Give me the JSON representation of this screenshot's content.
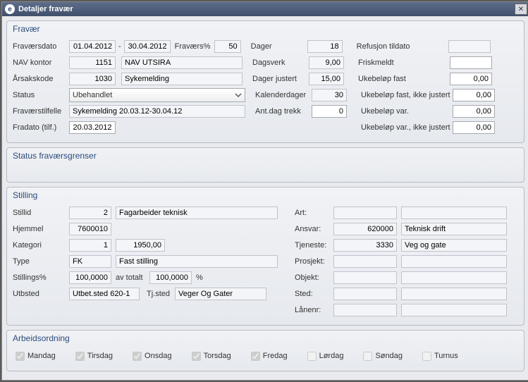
{
  "window": {
    "title": "Detaljer fravær"
  },
  "fravaer": {
    "legend": "Fravær",
    "fravaersdato_label": "Fraværsdato",
    "dato_fra": "01.04.2012",
    "dato_til": "30.04.2012",
    "fravaerspct_label": "Fraværs%",
    "fravaerspct": "50",
    "dager_label": "Dager",
    "dager": "18",
    "refusjon_label": "Refusjon tildato",
    "refusjon": "",
    "nav_label": "NAV kontor",
    "nav_kode": "1151",
    "nav_navn": "NAV UTSIRA",
    "dagsverk_label": "Dagsverk",
    "dagsverk": "9,00",
    "friskmeldt_label": "Friskmeldt",
    "friskmeldt": "",
    "aarsak_label": "Årsakskode",
    "aarsak_kode": "1030",
    "aarsak_navn": "Sykemelding",
    "dager_justert_label": "Dager justert",
    "dager_justert": "15,00",
    "ukebelop_fast_label": "Ukebeløp fast",
    "ukebelop_fast": "0,00",
    "status_label": "Status",
    "status": "Ubehandlet",
    "kalenderdager_label": "Kalenderdager",
    "kalenderdager": "30",
    "ukebelop_fast_ij_label": "Ukebeløp fast, ikke justert",
    "ukebelop_fast_ij": "0,00",
    "fravaerstilfelle_label": "Fraværstilfelle",
    "fravaerstilfelle": "Sykemelding 20.03.12-30.04.12",
    "antdag_label": "Ant.dag trekk",
    "antdag": "0",
    "ukebelop_var_label": "Ukebeløp var.",
    "ukebelop_var": "0,00",
    "fradato_label": "Fradato (tilf.)",
    "fradato": "20.03.2012",
    "ukebelop_var_ij_label": "Ukebeløp var., ikke justert",
    "ukebelop_var_ij": "0,00"
  },
  "status_fg": {
    "legend": "Status fraværsgrenser"
  },
  "stilling": {
    "legend": "Stilling",
    "stillid_label": "Stillid",
    "stillid": "2",
    "stillid_navn": "Fagarbeider teknisk",
    "hjemmel_label": "Hjemmel",
    "hjemmel": "7600010",
    "kategori_label": "Kategori",
    "kategori": "1",
    "kategori_v": "1950,00",
    "type_label": "Type",
    "type_kode": "FK",
    "type_navn": "Fast stilling",
    "stillingspct_label": "Stillings%",
    "stillingspct": "100,0000",
    "avtotalt_label": "av totalt",
    "totalt": "100,0000",
    "pct_sign": "%",
    "utbsted_label": "Utbsted",
    "utbsted": "Utbet.sted 620-1",
    "tjsted_label": "Tj.sted",
    "tjsted": "Veger Og Gater",
    "art_label": "Art:",
    "art": "",
    "art_navn": "",
    "ansvar_label": "Ansvar:",
    "ansvar": "620000",
    "ansvar_navn": "Teknisk drift",
    "tjeneste_label": "Tjeneste:",
    "tjeneste": "3330",
    "tjeneste_navn": "Veg og gate",
    "prosjekt_label": "Prosjekt:",
    "objekt_label": "Objekt:",
    "sted_label": "Sted:",
    "lanenr_label": "Lånenr:"
  },
  "arbeidsordning": {
    "legend": "Arbeidsordning",
    "mandag": "Mandag",
    "tirsdag": "Tirsdag",
    "onsdag": "Onsdag",
    "torsdag": "Torsdag",
    "fredag": "Fredag",
    "lordag": "Lørdag",
    "sondag": "Søndag",
    "turnus": "Turnus"
  }
}
